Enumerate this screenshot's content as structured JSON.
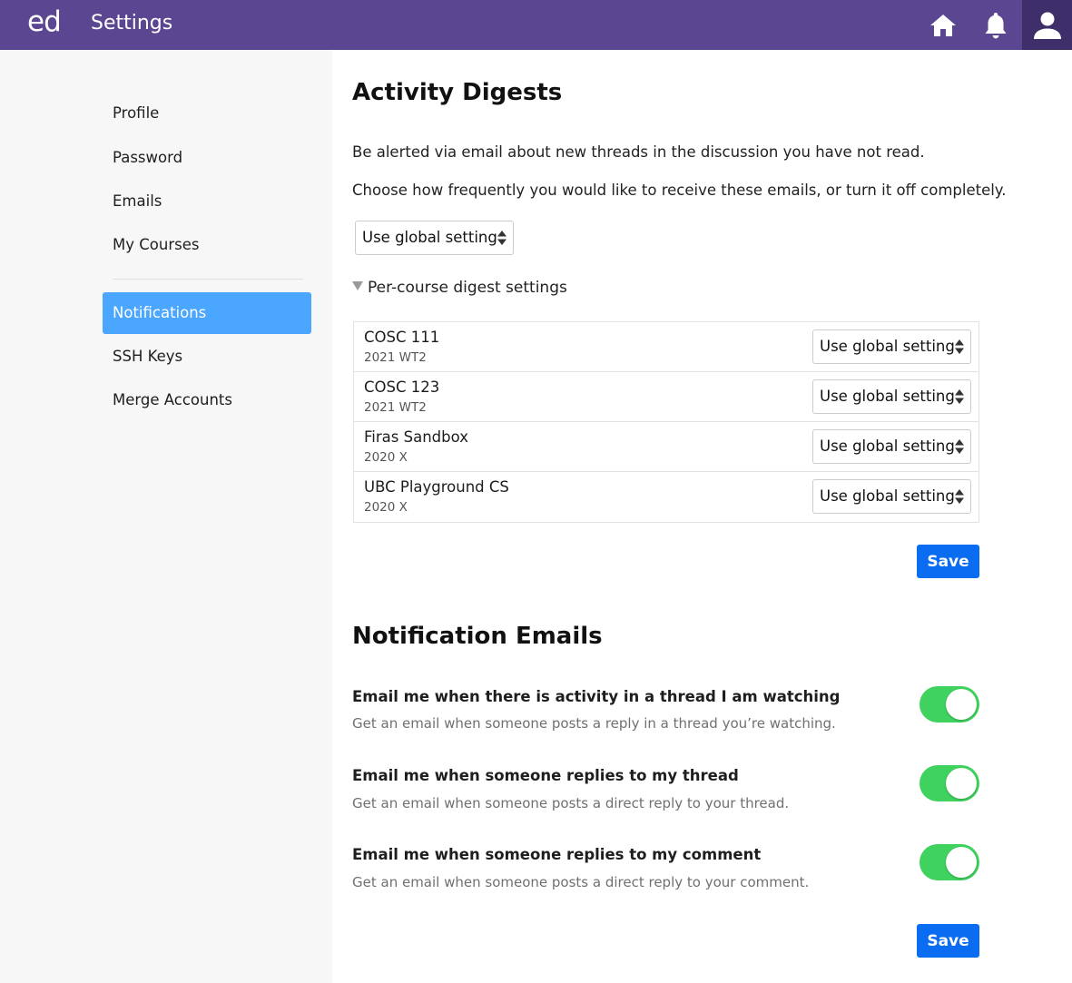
{
  "header": {
    "logo": "ed",
    "title": "Settings",
    "icons": [
      "home-icon",
      "bell-icon",
      "user-icon"
    ],
    "color": "#5b4691"
  },
  "sidebar": {
    "items": [
      {
        "label": "Profile"
      },
      {
        "label": "Password"
      },
      {
        "label": "Emails"
      },
      {
        "label": "My Courses"
      },
      {
        "label": "Notifications",
        "active": true
      },
      {
        "label": "SSH Keys"
      },
      {
        "label": "Merge Accounts"
      }
    ],
    "active_color": "#4ba6ff"
  },
  "digests": {
    "heading": "Activity Digests",
    "desc1": "Be alerted via email about new threads in the discussion you have not read.",
    "desc2": "Choose how frequently you would like to receive these emails, or turn it off completely.",
    "global_select": "Use global setting",
    "per_course_toggle": "Per-course digest settings",
    "courses": [
      {
        "name": "COSC 111",
        "term": "2021 WT2",
        "setting": "Use global setting"
      },
      {
        "name": "COSC 123",
        "term": "2021 WT2",
        "setting": "Use global setting"
      },
      {
        "name": "Firas Sandbox",
        "term": "2020 X",
        "setting": "Use global setting"
      },
      {
        "name": "UBC Playground CS",
        "term": "2020 X",
        "setting": "Use global setting"
      }
    ],
    "save_label": "Save"
  },
  "notifications": {
    "heading": "Notification Emails",
    "options": [
      {
        "title": "Email me when there is activity in a thread I am watching",
        "desc": "Get an email when someone posts a reply in a thread you’re watching.",
        "enabled": true
      },
      {
        "title": "Email me when someone replies to my thread",
        "desc": "Get an email when someone posts a direct reply to your thread.",
        "enabled": true
      },
      {
        "title": "Email me when someone replies to my comment",
        "desc": "Get an email when someone posts a direct reply to your comment.",
        "enabled": true
      }
    ],
    "save_label": "Save",
    "toggle_color": "#3fd25e"
  },
  "colors": {
    "save_button": "#0a6cf0"
  }
}
